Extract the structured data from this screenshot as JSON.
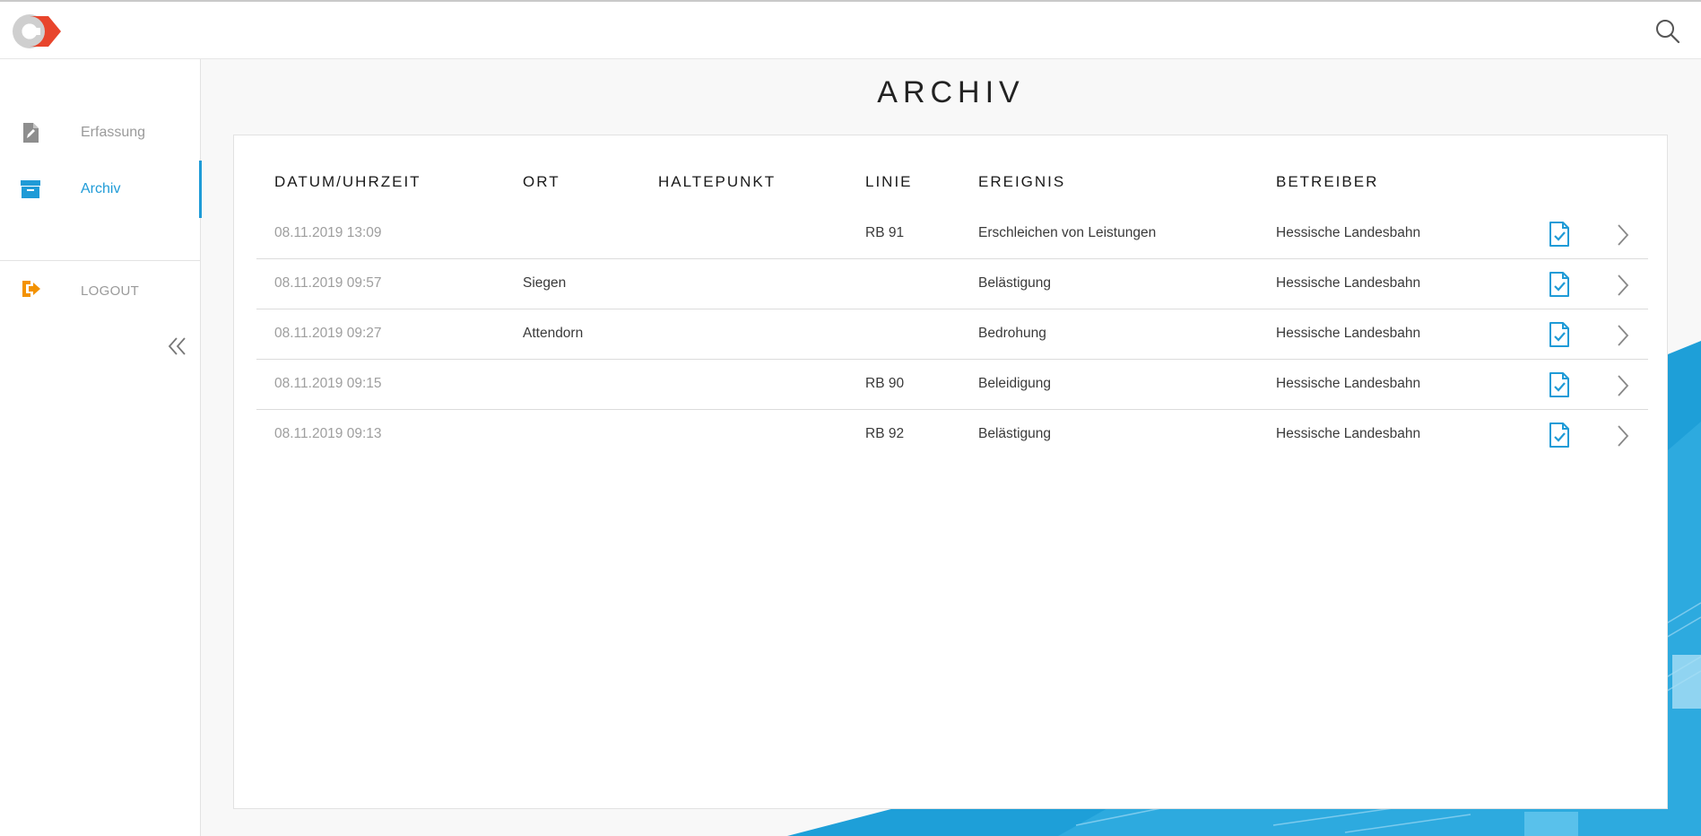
{
  "header": {
    "logo_icon": "app-logo",
    "search_icon": "search-icon"
  },
  "sidebar": {
    "items": [
      {
        "label": "Erfassung",
        "icon": "document-edit-icon",
        "active": false
      },
      {
        "label": "Archiv",
        "icon": "archive-box-icon",
        "active": true
      },
      {
        "label": "LOGOUT",
        "icon": "logout-icon",
        "active": false
      }
    ],
    "collapse_icon": "double-chevron-left-icon"
  },
  "page": {
    "title": "ARCHIV"
  },
  "table": {
    "columns": [
      "DATUM/UHRZEIT",
      "ORT",
      "HALTEPUNKT",
      "LINIE",
      "EREIGNIS",
      "BETREIBER"
    ],
    "rows": [
      {
        "datetime": "08.11.2019 13:09",
        "ort": "",
        "haltepunkt": "",
        "linie": "RB 91",
        "ereignis": "Erschleichen von Leistungen",
        "betreiber": "Hessische Landesbahn"
      },
      {
        "datetime": "08.11.2019 09:57",
        "ort": "Siegen",
        "haltepunkt": "",
        "linie": "",
        "ereignis": "Belästigung",
        "betreiber": "Hessische Landesbahn"
      },
      {
        "datetime": "08.11.2019 09:27",
        "ort": "Attendorn",
        "haltepunkt": "",
        "linie": "",
        "ereignis": "Bedrohung",
        "betreiber": "Hessische Landesbahn"
      },
      {
        "datetime": "08.11.2019 09:15",
        "ort": "",
        "haltepunkt": "",
        "linie": "RB 90",
        "ereignis": "Beleidigung",
        "betreiber": "Hessische Landesbahn"
      },
      {
        "datetime": "08.11.2019 09:13",
        "ort": "",
        "haltepunkt": "",
        "linie": "RB 92",
        "ereignis": "Belästigung",
        "betreiber": "Hessische Landesbahn"
      }
    ],
    "row_icons": [
      "document-check-icon",
      "chevron-right-icon"
    ]
  },
  "colors": {
    "accent": "#1f9bd7",
    "logout_icon": "#f39200",
    "logo_red": "#e8452c",
    "deco_blue": "#1e9fd8"
  }
}
